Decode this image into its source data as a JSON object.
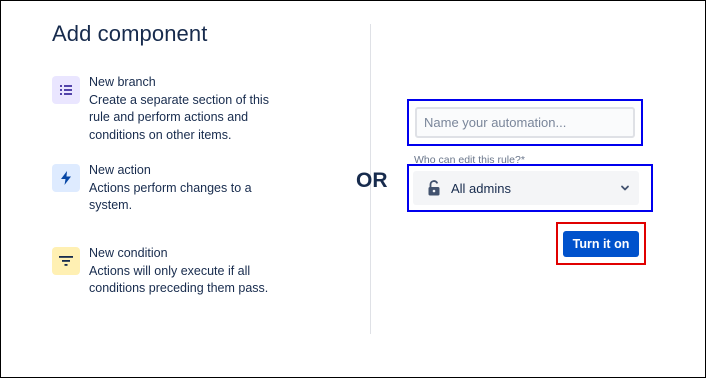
{
  "panel": {
    "title": "Add component"
  },
  "components": [
    {
      "name": "New branch",
      "description": "Create a separate section of this rule and perform actions and conditions on other items.",
      "icon": "branch-list-icon",
      "icon_bg": "#eae6ff",
      "icon_color": "#5243aa"
    },
    {
      "name": "New action",
      "description": "Actions perform changes to a system.",
      "icon": "lightning-bolt-icon",
      "icon_bg": "#deebff",
      "icon_color": "#0747a6"
    },
    {
      "name": "New condition",
      "description": "Actions will only execute if all conditions preceding them pass.",
      "icon": "filter-icon",
      "icon_bg": "#fff0b3",
      "icon_color": "#172b4d"
    }
  ],
  "separator": {
    "label": "OR"
  },
  "form": {
    "name_placeholder": "Name your automation...",
    "name_value": "",
    "permission_label": "Who can edit this rule?",
    "permission_required_mark": "*",
    "permission_value": "All admins",
    "submit_label": "Turn it on"
  },
  "colors": {
    "primary": "#0052cc",
    "text": "#172b4d",
    "highlight_blue": "#0000ee",
    "highlight_red": "#e00000"
  }
}
